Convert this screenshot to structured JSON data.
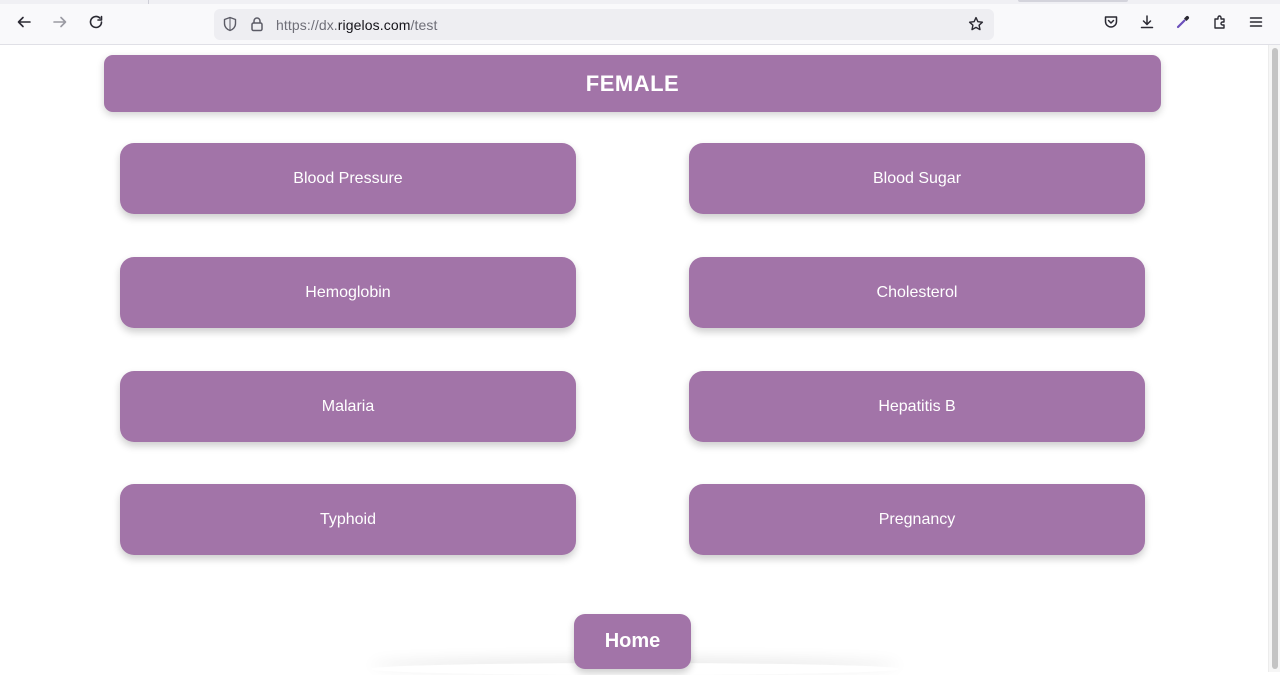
{
  "browser": {
    "url_domain_prefix": "https://dx.",
    "url_domain_main": "rigelos.com",
    "url_path": "/test"
  },
  "page": {
    "header_title": "FEMALE",
    "tests": [
      {
        "label": "Blood Pressure"
      },
      {
        "label": "Blood Sugar"
      },
      {
        "label": "Hemoglobin"
      },
      {
        "label": "Cholesterol"
      },
      {
        "label": "Malaria"
      },
      {
        "label": "Hepatitis B"
      },
      {
        "label": "Typhoid"
      },
      {
        "label": "Pregnancy"
      }
    ],
    "home_label": "Home"
  },
  "colors": {
    "accent": "#a274a8",
    "text_on_accent": "#ffffff"
  },
  "icons": [
    "back-icon",
    "forward-icon",
    "reload-icon",
    "shield-icon",
    "lock-icon",
    "star-icon",
    "pocket-icon",
    "download-icon",
    "eyedropper-icon",
    "extensions-icon",
    "menu-icon"
  ]
}
